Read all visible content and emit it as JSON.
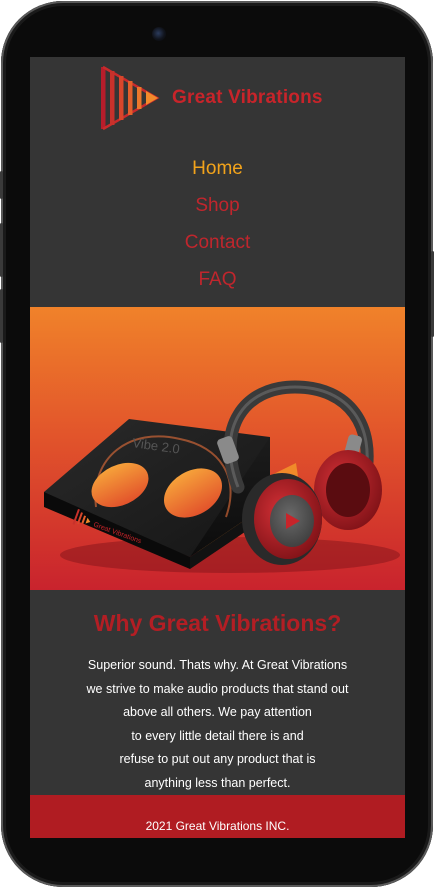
{
  "brand": {
    "name": "Great Vibrations"
  },
  "nav": {
    "items": [
      {
        "label": "Home",
        "active": true
      },
      {
        "label": "Shop",
        "active": false
      },
      {
        "label": "Contact",
        "active": false
      },
      {
        "label": "FAQ",
        "active": false
      }
    ]
  },
  "hero": {
    "box_text": "Vibe 2.0",
    "box_brand": "Great Vibrations"
  },
  "about": {
    "heading": "Why Great Vibrations?",
    "lines": [
      "Superior sound. Thats why. At Great Vibrations",
      "we strive to make audio products that stand out",
      "above all others. We pay attention",
      "to every little detail there is and",
      "refuse to put out any product that is",
      "anything less than perfect."
    ]
  },
  "footer": {
    "text": "2021 Great Vibrations INC."
  },
  "colors": {
    "brand_red": "#c8242a",
    "nav_active": "#f2a31b",
    "background": "#353535",
    "footer": "#b01c22"
  }
}
